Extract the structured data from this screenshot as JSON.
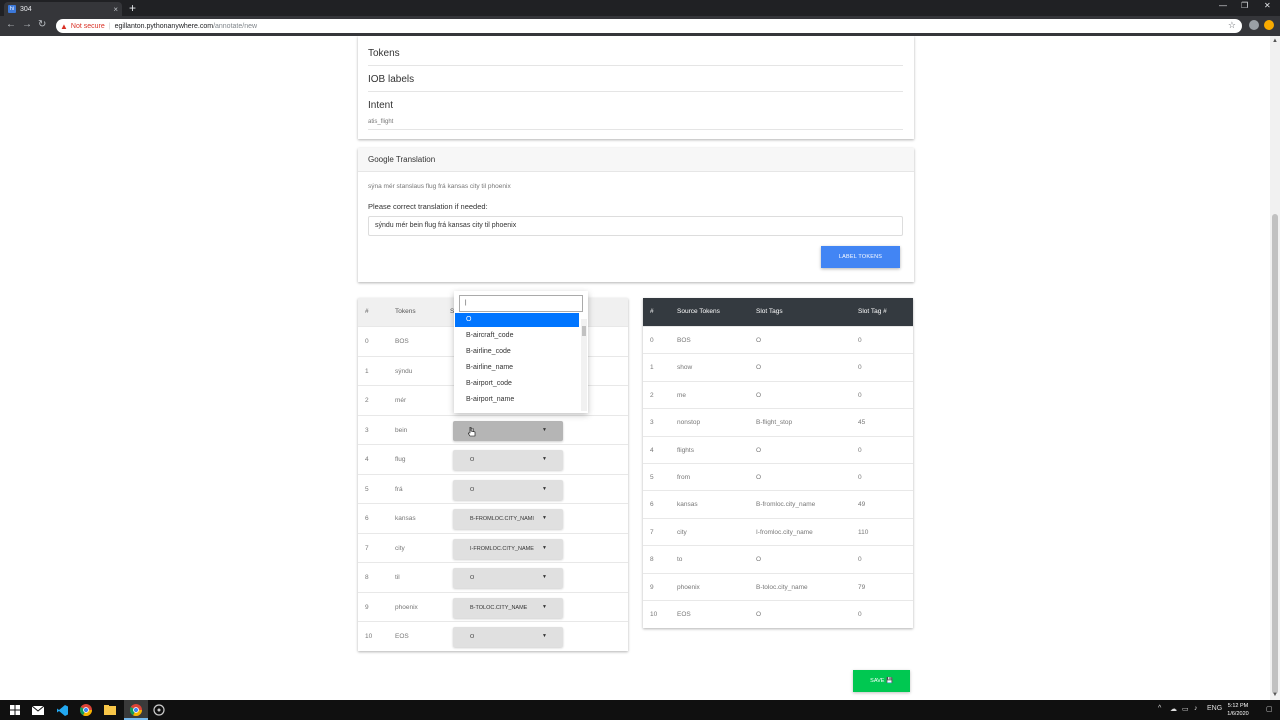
{
  "browser": {
    "tab_favicon": "hi",
    "tab_title": "304",
    "tab_close": "×",
    "new_tab": "+",
    "win_min": "—",
    "win_max": "❐",
    "win_close": "✕",
    "not_secure": "Not secure",
    "url_host": "egillanton.pythonanywhere.com",
    "url_path": "/annotate/new"
  },
  "top_card": {
    "tokens_heading": "Tokens",
    "iob_heading": "IOB labels",
    "intent_heading": "Intent",
    "intent_value": "atis_flight"
  },
  "translation": {
    "header": "Google Translation",
    "translated_text": "sýna mér stanslaus flug frá kansas city til phoenix",
    "correct_label": "Please correct translation if needed:",
    "input_value": "sýndu mér bein flug frá kansas city til phoenix",
    "label_button": "LABEL TOKENS"
  },
  "left_table": {
    "headers": {
      "num": "#",
      "tokens": "Tokens",
      "slot": "S"
    },
    "rows": [
      {
        "num": "0",
        "token": "BOS",
        "slot": ""
      },
      {
        "num": "1",
        "token": "sýndu",
        "slot": ""
      },
      {
        "num": "2",
        "token": "mér",
        "slot": ""
      },
      {
        "num": "3",
        "token": "bein",
        "slot": "O"
      },
      {
        "num": "4",
        "token": "flug",
        "slot": "O"
      },
      {
        "num": "5",
        "token": "frá",
        "slot": "O"
      },
      {
        "num": "6",
        "token": "kansas",
        "slot": "B-FROMLOC.CITY_NAMI"
      },
      {
        "num": "7",
        "token": "city",
        "slot": "I-FROMLOC.CITY_NAME"
      },
      {
        "num": "8",
        "token": "til",
        "slot": "O"
      },
      {
        "num": "9",
        "token": "phoenix",
        "slot": "B-TOLOC.CITY_NAME"
      },
      {
        "num": "10",
        "token": "EOS",
        "slot": "O"
      }
    ]
  },
  "dropdown": {
    "search_value": "|",
    "options": [
      "O",
      "B-aircraft_code",
      "B-airline_code",
      "B-airline_name",
      "B-airport_code",
      "B-airport_name"
    ],
    "selected": "O"
  },
  "right_table": {
    "headers": {
      "num": "#",
      "source": "Source Tokens",
      "slot_tags": "Slot Tags",
      "slot_num": "Slot Tag #"
    },
    "rows": [
      {
        "num": "0",
        "source": "BOS",
        "tag": "O",
        "tag_num": "0"
      },
      {
        "num": "1",
        "source": "show",
        "tag": "O",
        "tag_num": "0"
      },
      {
        "num": "2",
        "source": "me",
        "tag": "O",
        "tag_num": "0"
      },
      {
        "num": "3",
        "source": "nonstop",
        "tag": "B-flight_stop",
        "tag_num": "45"
      },
      {
        "num": "4",
        "source": "flights",
        "tag": "O",
        "tag_num": "0"
      },
      {
        "num": "5",
        "source": "from",
        "tag": "O",
        "tag_num": "0"
      },
      {
        "num": "6",
        "source": "kansas",
        "tag": "B-fromloc.city_name",
        "tag_num": "49"
      },
      {
        "num": "7",
        "source": "city",
        "tag": "I-fromloc.city_name",
        "tag_num": "110"
      },
      {
        "num": "8",
        "source": "to",
        "tag": "O",
        "tag_num": "0"
      },
      {
        "num": "9",
        "source": "phoenix",
        "tag": "B-toloc.city_name",
        "tag_num": "79"
      },
      {
        "num": "10",
        "source": "EOS",
        "tag": "O",
        "tag_num": "0"
      }
    ]
  },
  "save_button": "SAVE 💾",
  "taskbar": {
    "time": "5:12 PM",
    "date": "1/6/2020"
  },
  "colors": {
    "primary_button": "#4285f4",
    "save_button": "#00c851",
    "dark_header": "#343a40",
    "dropdown_selected": "#0075ff"
  }
}
